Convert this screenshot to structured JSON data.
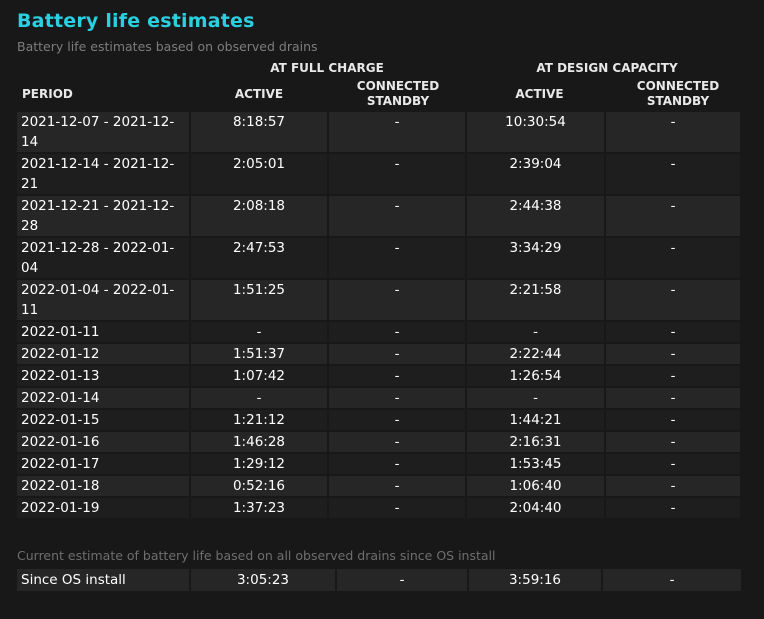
{
  "title": "Battery life estimates",
  "subtitle": "Battery life estimates based on observed drains",
  "groups": {
    "full": "AT FULL CHARGE",
    "design": "AT DESIGN CAPACITY"
  },
  "columns": {
    "period": "PERIOD",
    "active_full": "ACTIVE",
    "standby_full_1": "CONNECTED",
    "standby_full_2": "STANDBY",
    "active_design": "ACTIVE",
    "standby_design_1": "CONNECTED",
    "standby_design_2": "STANDBY"
  },
  "rows": [
    {
      "period": "2021-12-07 - 2021-12-14",
      "active_full": "8:18:57",
      "standby_full": "-",
      "active_design": "10:30:54",
      "standby_design": "-"
    },
    {
      "period": "2021-12-14 - 2021-12-21",
      "active_full": "2:05:01",
      "standby_full": "-",
      "active_design": "2:39:04",
      "standby_design": "-"
    },
    {
      "period": "2021-12-21 - 2021-12-28",
      "active_full": "2:08:18",
      "standby_full": "-",
      "active_design": "2:44:38",
      "standby_design": "-"
    },
    {
      "period": "2021-12-28 - 2022-01-04",
      "active_full": "2:47:53",
      "standby_full": "-",
      "active_design": "3:34:29",
      "standby_design": "-"
    },
    {
      "period": "2022-01-04 - 2022-01-11",
      "active_full": "1:51:25",
      "standby_full": "-",
      "active_design": "2:21:58",
      "standby_design": "-"
    },
    {
      "period": "2022-01-11",
      "active_full": "-",
      "standby_full": "-",
      "active_design": "-",
      "standby_design": "-"
    },
    {
      "period": "2022-01-12",
      "active_full": "1:51:37",
      "standby_full": "-",
      "active_design": "2:22:44",
      "standby_design": "-"
    },
    {
      "period": "2022-01-13",
      "active_full": "1:07:42",
      "standby_full": "-",
      "active_design": "1:26:54",
      "standby_design": "-"
    },
    {
      "period": "2022-01-14",
      "active_full": "-",
      "standby_full": "-",
      "active_design": "-",
      "standby_design": "-"
    },
    {
      "period": "2022-01-15",
      "active_full": "1:21:12",
      "standby_full": "-",
      "active_design": "1:44:21",
      "standby_design": "-"
    },
    {
      "period": "2022-01-16",
      "active_full": "1:46:28",
      "standby_full": "-",
      "active_design": "2:16:31",
      "standby_design": "-"
    },
    {
      "period": "2022-01-17",
      "active_full": "1:29:12",
      "standby_full": "-",
      "active_design": "1:53:45",
      "standby_design": "-"
    },
    {
      "period": "2022-01-18",
      "active_full": "0:52:16",
      "standby_full": "-",
      "active_design": "1:06:40",
      "standby_design": "-"
    },
    {
      "period": "2022-01-19",
      "active_full": "1:37:23",
      "standby_full": "-",
      "active_design": "2:04:40",
      "standby_design": "-"
    }
  ],
  "since_note": "Current estimate of battery life based on all observed drains since OS install",
  "since": {
    "period": "Since OS install",
    "active_full": "3:05:23",
    "standby_full": "-",
    "active_design": "3:59:16",
    "standby_design": "-"
  }
}
